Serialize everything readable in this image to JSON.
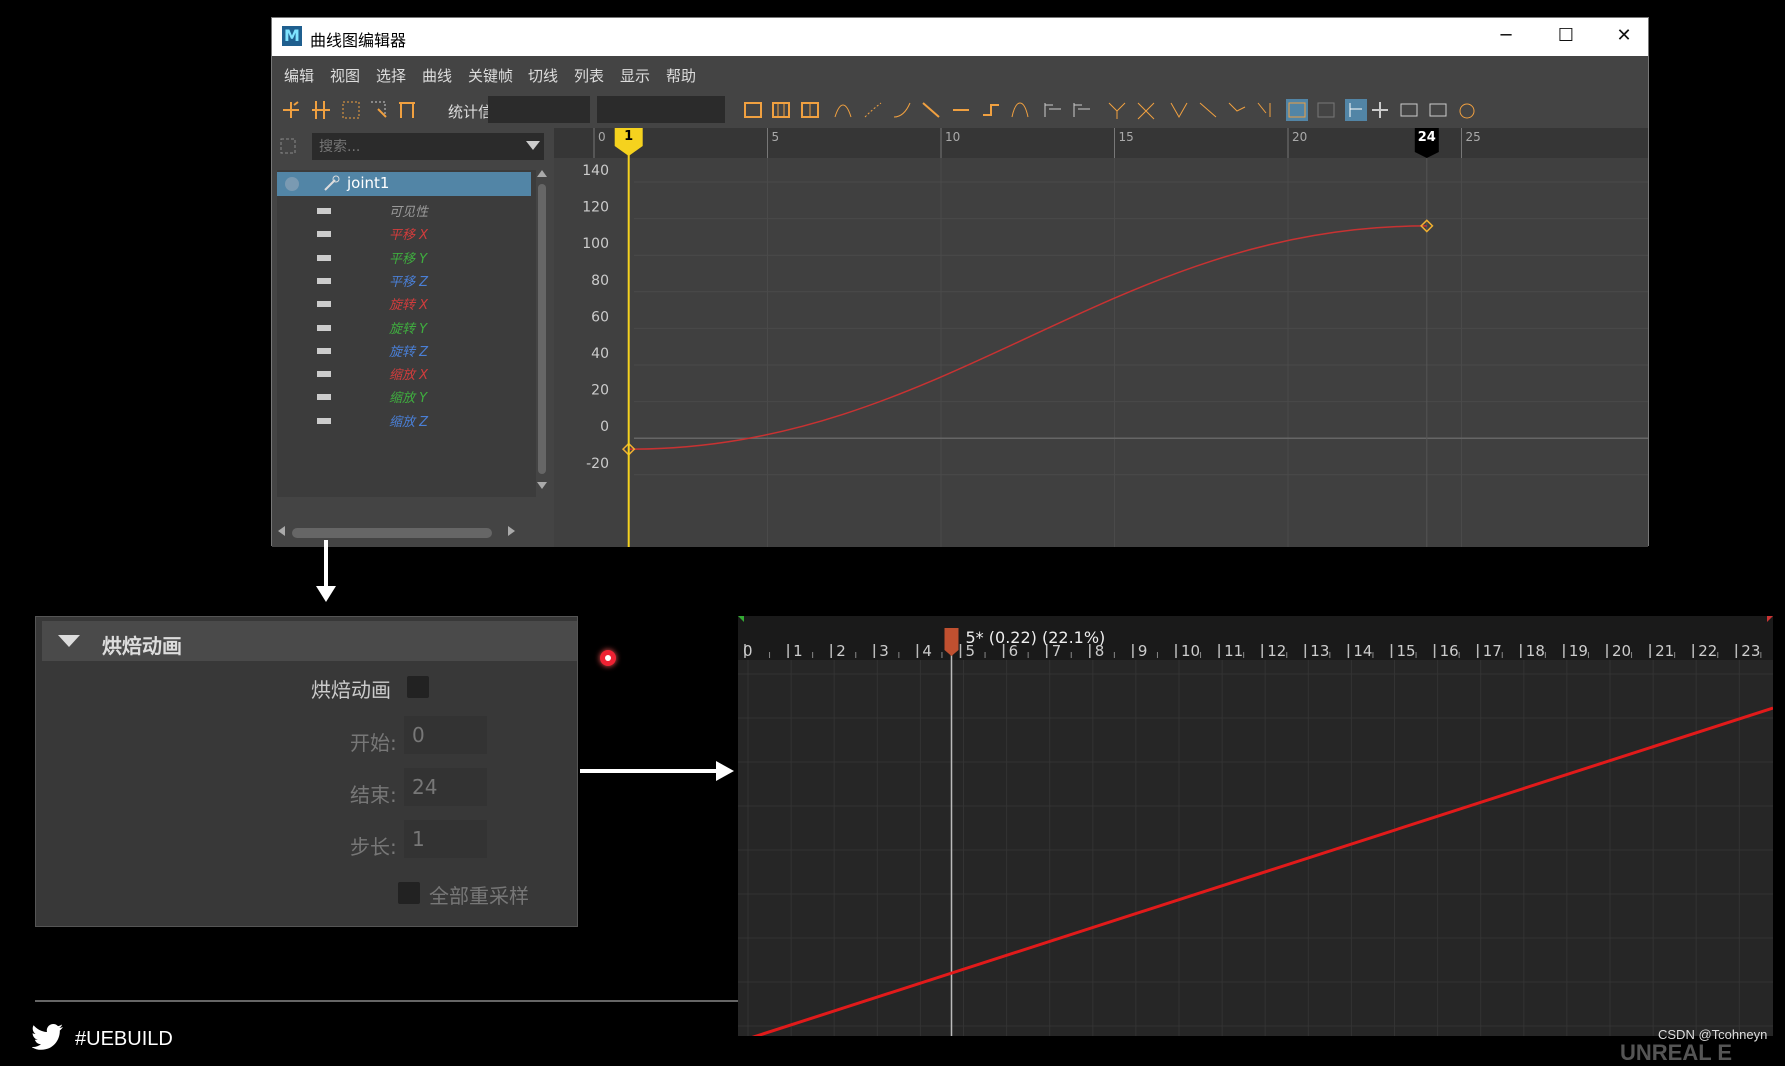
{
  "window": {
    "title": "曲线图编辑器",
    "logo": "M",
    "controls": [
      "─",
      "☐",
      "✕"
    ]
  },
  "menu": [
    "编辑",
    "视图",
    "选择",
    "曲线",
    "关键帧",
    "切线",
    "列表",
    "显示",
    "帮助"
  ],
  "toolbar": {
    "stats_label": "统计信息",
    "field1": "",
    "field2": ""
  },
  "outliner": {
    "search_placeholder": "搜索...",
    "node": "joint1",
    "channels": [
      {
        "label": "可见性",
        "color": "#9a9a9a"
      },
      {
        "label": "平移 X",
        "color": "#d23c3c"
      },
      {
        "label": "平移 Y",
        "color": "#3fae3f"
      },
      {
        "label": "平移 Z",
        "color": "#4a7fd6"
      },
      {
        "label": "旋转 X",
        "color": "#d23c3c"
      },
      {
        "label": "旋转 Y",
        "color": "#3fae3f"
      },
      {
        "label": "旋转 Z",
        "color": "#4a7fd6"
      },
      {
        "label": "缩放 X",
        "color": "#d23c3c"
      },
      {
        "label": "缩放 Y",
        "color": "#3fae3f"
      },
      {
        "label": "缩放 Z",
        "color": "#4a7fd6"
      }
    ]
  },
  "maya_graph": {
    "ruler_ticks": [
      "0",
      "5",
      "10",
      "15",
      "20",
      "25"
    ],
    "current_frame": "1",
    "end_frame": "24",
    "y_ticks": [
      "140",
      "120",
      "100",
      "80",
      "60",
      "40",
      "20",
      "0",
      "-20"
    ],
    "keys": [
      {
        "frame": 1,
        "value": -6
      },
      {
        "frame": 24,
        "value": 116
      }
    ]
  },
  "bake_panel": {
    "header": "烘焙动画",
    "bake_label": "烘焙动画",
    "start_label": "开始:",
    "start_value": "0",
    "end_label": "结束:",
    "end_value": "24",
    "step_label": "步长:",
    "step_value": "1",
    "resample_label": "全部重采样"
  },
  "ue_curve": {
    "ruler_ticks": [
      "0",
      "1",
      "2",
      "3",
      "4",
      "5",
      "6",
      "7",
      "8",
      "9",
      "10",
      "11",
      "12",
      "13",
      "14",
      "15",
      "16",
      "17",
      "18",
      "19",
      "20",
      "21",
      "22",
      "23"
    ],
    "scrub_label": "5* (0.22) (22.1%)",
    "scrub_frame": 5
  },
  "footer": {
    "hashtag": "#UEBUILD",
    "watermark": "CSDN @Tcohneyn",
    "logo_partial": "UNREAL E"
  },
  "colors": {
    "curve": "#c83232",
    "ue_curve": "#e11a1a",
    "playhead": "#f5d21e",
    "selection": "#5285a6"
  }
}
